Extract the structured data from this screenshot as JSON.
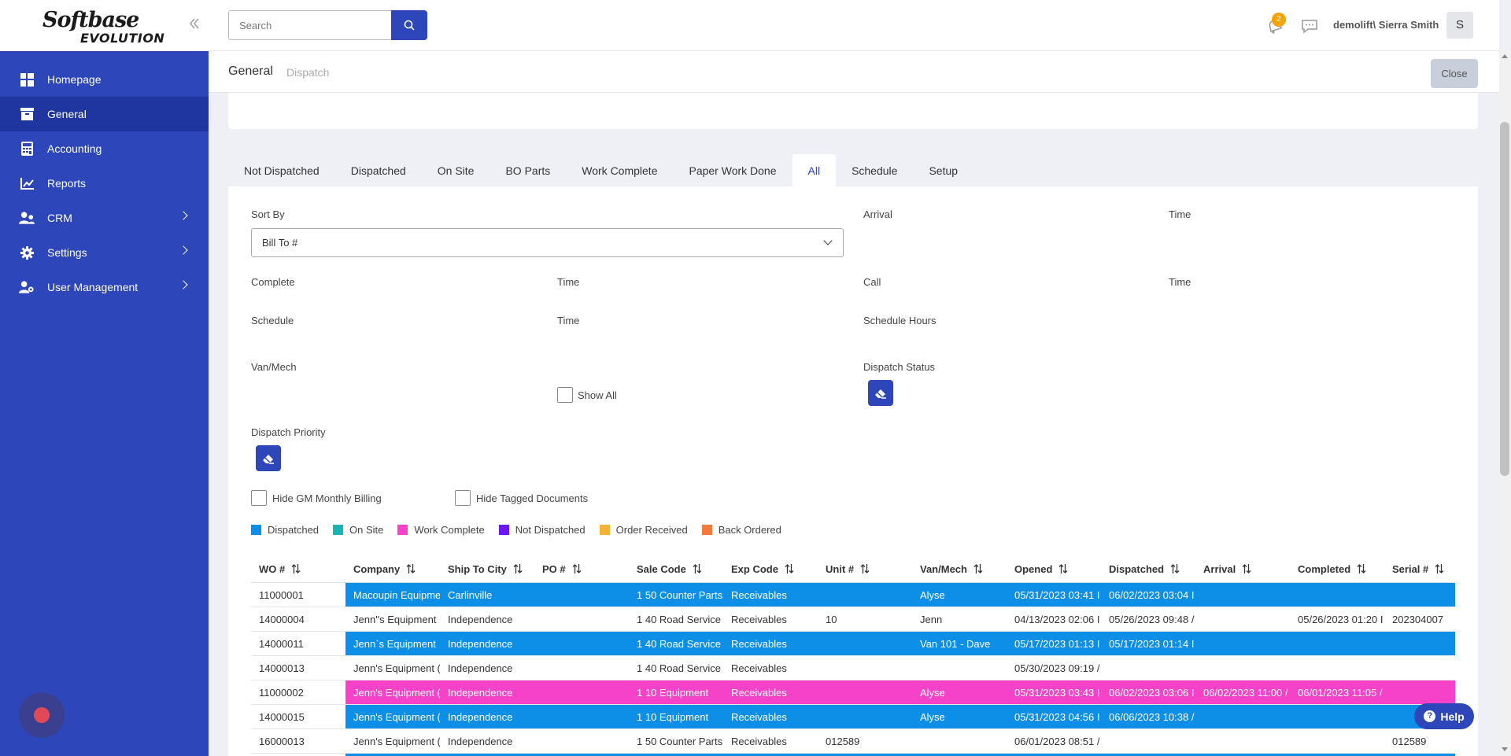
{
  "app": {
    "logo_top": "Softbase",
    "logo_bottom": "EVOLUTION"
  },
  "sidebar": {
    "items": [
      {
        "label": "Homepage",
        "icon": "grid-icon",
        "active": false
      },
      {
        "label": "General",
        "icon": "archive-icon",
        "active": true
      },
      {
        "label": "Accounting",
        "icon": "calculator-icon",
        "active": false
      },
      {
        "label": "Reports",
        "icon": "chart-icon",
        "active": false
      },
      {
        "label": "CRM",
        "icon": "users-icon",
        "active": false,
        "has_children": true
      },
      {
        "label": "Settings",
        "icon": "gear-icon",
        "active": false,
        "has_children": true
      },
      {
        "label": "User Management",
        "icon": "user-gear-icon",
        "active": false,
        "has_children": true
      }
    ]
  },
  "header": {
    "search_placeholder": "Search",
    "notification_count": "2",
    "username": "demolift\\ Sierra Smith",
    "avatar_initial": "S"
  },
  "breadcrumb": {
    "main": "General",
    "sub": "Dispatch",
    "close_label": "Close"
  },
  "tabs": [
    {
      "label": "Not Dispatched",
      "active": false
    },
    {
      "label": "Dispatched",
      "active": false
    },
    {
      "label": "On Site",
      "active": false
    },
    {
      "label": "BO Parts",
      "active": false
    },
    {
      "label": "Work Complete",
      "active": false
    },
    {
      "label": "Paper Work Done",
      "active": false
    },
    {
      "label": "All",
      "active": true
    },
    {
      "label": "Schedule",
      "active": false
    },
    {
      "label": "Setup",
      "active": false
    }
  ],
  "filters": {
    "sort_by_label": "Sort By",
    "sort_by_value": "Bill To #",
    "arrival_label": "Arrival",
    "arrival_time_label": "Time",
    "complete_label": "Complete",
    "complete_time_label": "Time",
    "call_label": "Call",
    "call_time_label": "Time",
    "schedule_label": "Schedule",
    "schedule_time_label": "Time",
    "schedule_hours_label": "Schedule Hours",
    "van_mech_label": "Van/Mech",
    "show_all_label": "Show All",
    "dispatch_status_label": "Dispatch Status",
    "dispatch_priority_label": "Dispatch Priority",
    "hide_gm_label": "Hide GM Monthly Billing",
    "hide_tagged_label": "Hide Tagged Documents"
  },
  "legend": [
    {
      "label": "Dispatched",
      "color": "#0d8fe8"
    },
    {
      "label": "On Site",
      "color": "#1ab4b4"
    },
    {
      "label": "Work Complete",
      "color": "#f542c8"
    },
    {
      "label": "Not Dispatched",
      "color": "#6a18f0"
    },
    {
      "label": "Order Received",
      "color": "#f5b335"
    },
    {
      "label": "Back Ordered",
      "color": "#f5783d"
    }
  ],
  "table": {
    "columns": [
      "WO #",
      "Company",
      "Ship To City",
      "PO #",
      "Sale Code",
      "Exp Code",
      "Unit #",
      "Van/Mech",
      "Opened",
      "Dispatched",
      "Arrival",
      "Completed",
      "Serial #"
    ],
    "rows": [
      {
        "color": "#0d8fe8",
        "text": "#ffffff",
        "cells": [
          "11000001",
          "Macoupin Equipme",
          "Carlinville",
          "",
          "1 50 Counter Parts",
          "Receivables",
          "",
          "Alyse",
          "05/31/2023 03:41 I",
          "06/02/2023 03:04 I",
          "",
          "",
          ""
        ]
      },
      {
        "color": "#ffffff",
        "text": "#333333",
        "cells": [
          "14000004",
          "Jenn''s Equipment",
          "Independence",
          "",
          "1 40 Road Service",
          "Receivables",
          "10",
          "Jenn",
          "04/13/2023 02:06 I",
          "05/26/2023 09:48 /",
          "",
          "05/26/2023 01:20 I",
          "202304007"
        ]
      },
      {
        "color": "#0d8fe8",
        "text": "#ffffff",
        "cells": [
          "14000011",
          "Jenn`s Equipment",
          "Independence",
          "",
          "1 40 Road Service",
          "Receivables",
          "",
          "Van 101 - Dave",
          "05/17/2023 01:13 I",
          "05/17/2023 01:14 I",
          "",
          "",
          ""
        ]
      },
      {
        "color": "#ffffff",
        "text": "#333333",
        "cells": [
          "14000013",
          "Jenn's Equipment (",
          "Independence",
          "",
          "1 40 Road Service",
          "Receivables",
          "",
          "",
          "05/30/2023 09:19 /",
          "",
          "",
          "",
          ""
        ]
      },
      {
        "color": "#f542c8",
        "text": "#ffffff",
        "cells": [
          "11000002",
          "Jenn's Equipment (",
          "Independence",
          "",
          "1 10 Equipment",
          "Receivables",
          "",
          "Alyse",
          "05/31/2023 03:43 I",
          "06/02/2023 03:06 I",
          "06/02/2023 11:00 /",
          "06/01/2023 11:05 /",
          ""
        ]
      },
      {
        "color": "#0d8fe8",
        "text": "#ffffff",
        "cells": [
          "14000015",
          "Jenn's Equipment (",
          "Independence",
          "",
          "1 10 Equipment",
          "Receivables",
          "",
          "Alyse",
          "05/31/2023 04:56 I",
          "06/06/2023 10:38 /",
          "",
          "",
          ""
        ]
      },
      {
        "color": "#ffffff",
        "text": "#333333",
        "cells": [
          "16000013",
          "Jenn's Equipment (",
          "Independence",
          "",
          "1 50 Counter Parts",
          "Receivables",
          "012589",
          "",
          "06/01/2023 08:51 /",
          "",
          "",
          "",
          "012589"
        ]
      },
      {
        "color": "#0d8fe8",
        "text": "#ffffff",
        "cells": [
          "",
          "",
          "",
          "",
          "",
          "",
          "",
          "",
          "",
          "",
          "",
          "",
          ""
        ]
      }
    ]
  },
  "help": {
    "label": "Help"
  }
}
